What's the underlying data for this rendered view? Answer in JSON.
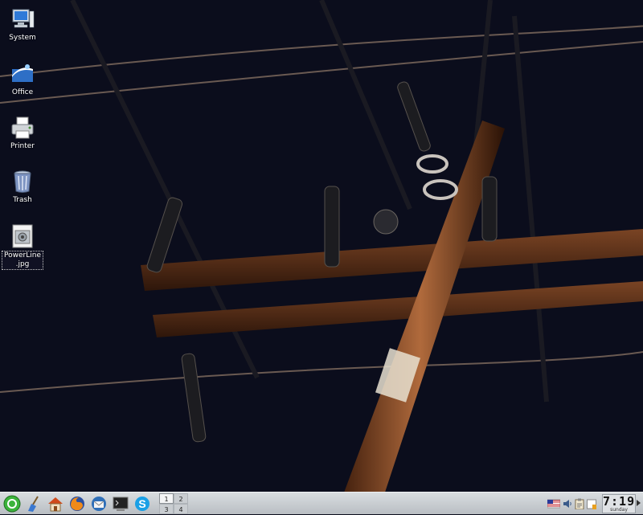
{
  "desktop": {
    "icons": [
      {
        "label": "System",
        "icon": "computer-icon"
      },
      {
        "label": "Office",
        "icon": "office-icon"
      },
      {
        "label": "Printer",
        "icon": "printer-icon"
      },
      {
        "label": "Trash",
        "icon": "trash-icon"
      },
      {
        "label": "PowerLine.jpg",
        "icon": "image-file-icon"
      }
    ]
  },
  "taskbar": {
    "launchers": [
      {
        "name": "start-menu",
        "icon": "green-menu-icon"
      },
      {
        "name": "clean",
        "icon": "broom-icon"
      },
      {
        "name": "home",
        "icon": "home-icon"
      },
      {
        "name": "firefox",
        "icon": "firefox-icon"
      },
      {
        "name": "thunderbird",
        "icon": "thunderbird-icon"
      },
      {
        "name": "terminal",
        "icon": "terminal-icon"
      },
      {
        "name": "skype",
        "icon": "skype-icon"
      }
    ],
    "pager": [
      "1",
      "2",
      "3",
      "4"
    ],
    "active_desktop": "1",
    "tray": [
      "keyboard-layout-icon",
      "volume-icon",
      "clipboard-icon",
      "update-icon"
    ],
    "clock": {
      "time": "7:19",
      "day": "sunday"
    }
  },
  "colors": {
    "sky": "#0b0d1c",
    "wood": "#6b3a1e",
    "taskbar": "#c9cdd1"
  }
}
